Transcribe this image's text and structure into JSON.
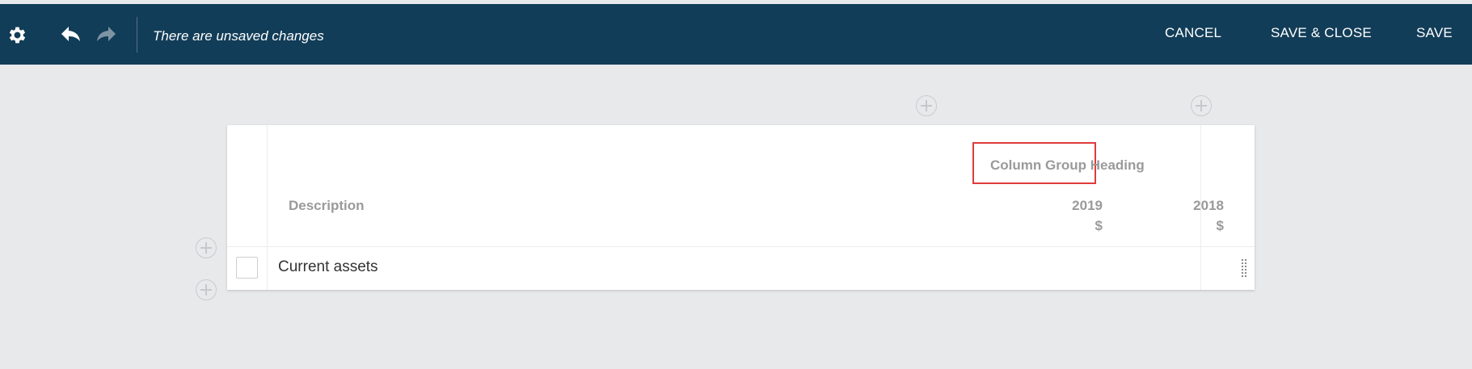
{
  "toolbar": {
    "status": "There are unsaved changes",
    "cancel_label": "CANCEL",
    "save_close_label": "SAVE & CLOSE",
    "save_label": "SAVE"
  },
  "table": {
    "column_group_heading": "Column Group Heading",
    "description_header": "Description",
    "columns": [
      {
        "year": "2019",
        "unit": "$"
      },
      {
        "year": "2018",
        "unit": "$"
      }
    ],
    "rows": [
      {
        "label": "Current assets"
      }
    ]
  },
  "colors": {
    "topbar": "#123d58",
    "background": "#e8e9eb",
    "highlight": "#e03b3b",
    "header_text": "#9a9a9a"
  }
}
